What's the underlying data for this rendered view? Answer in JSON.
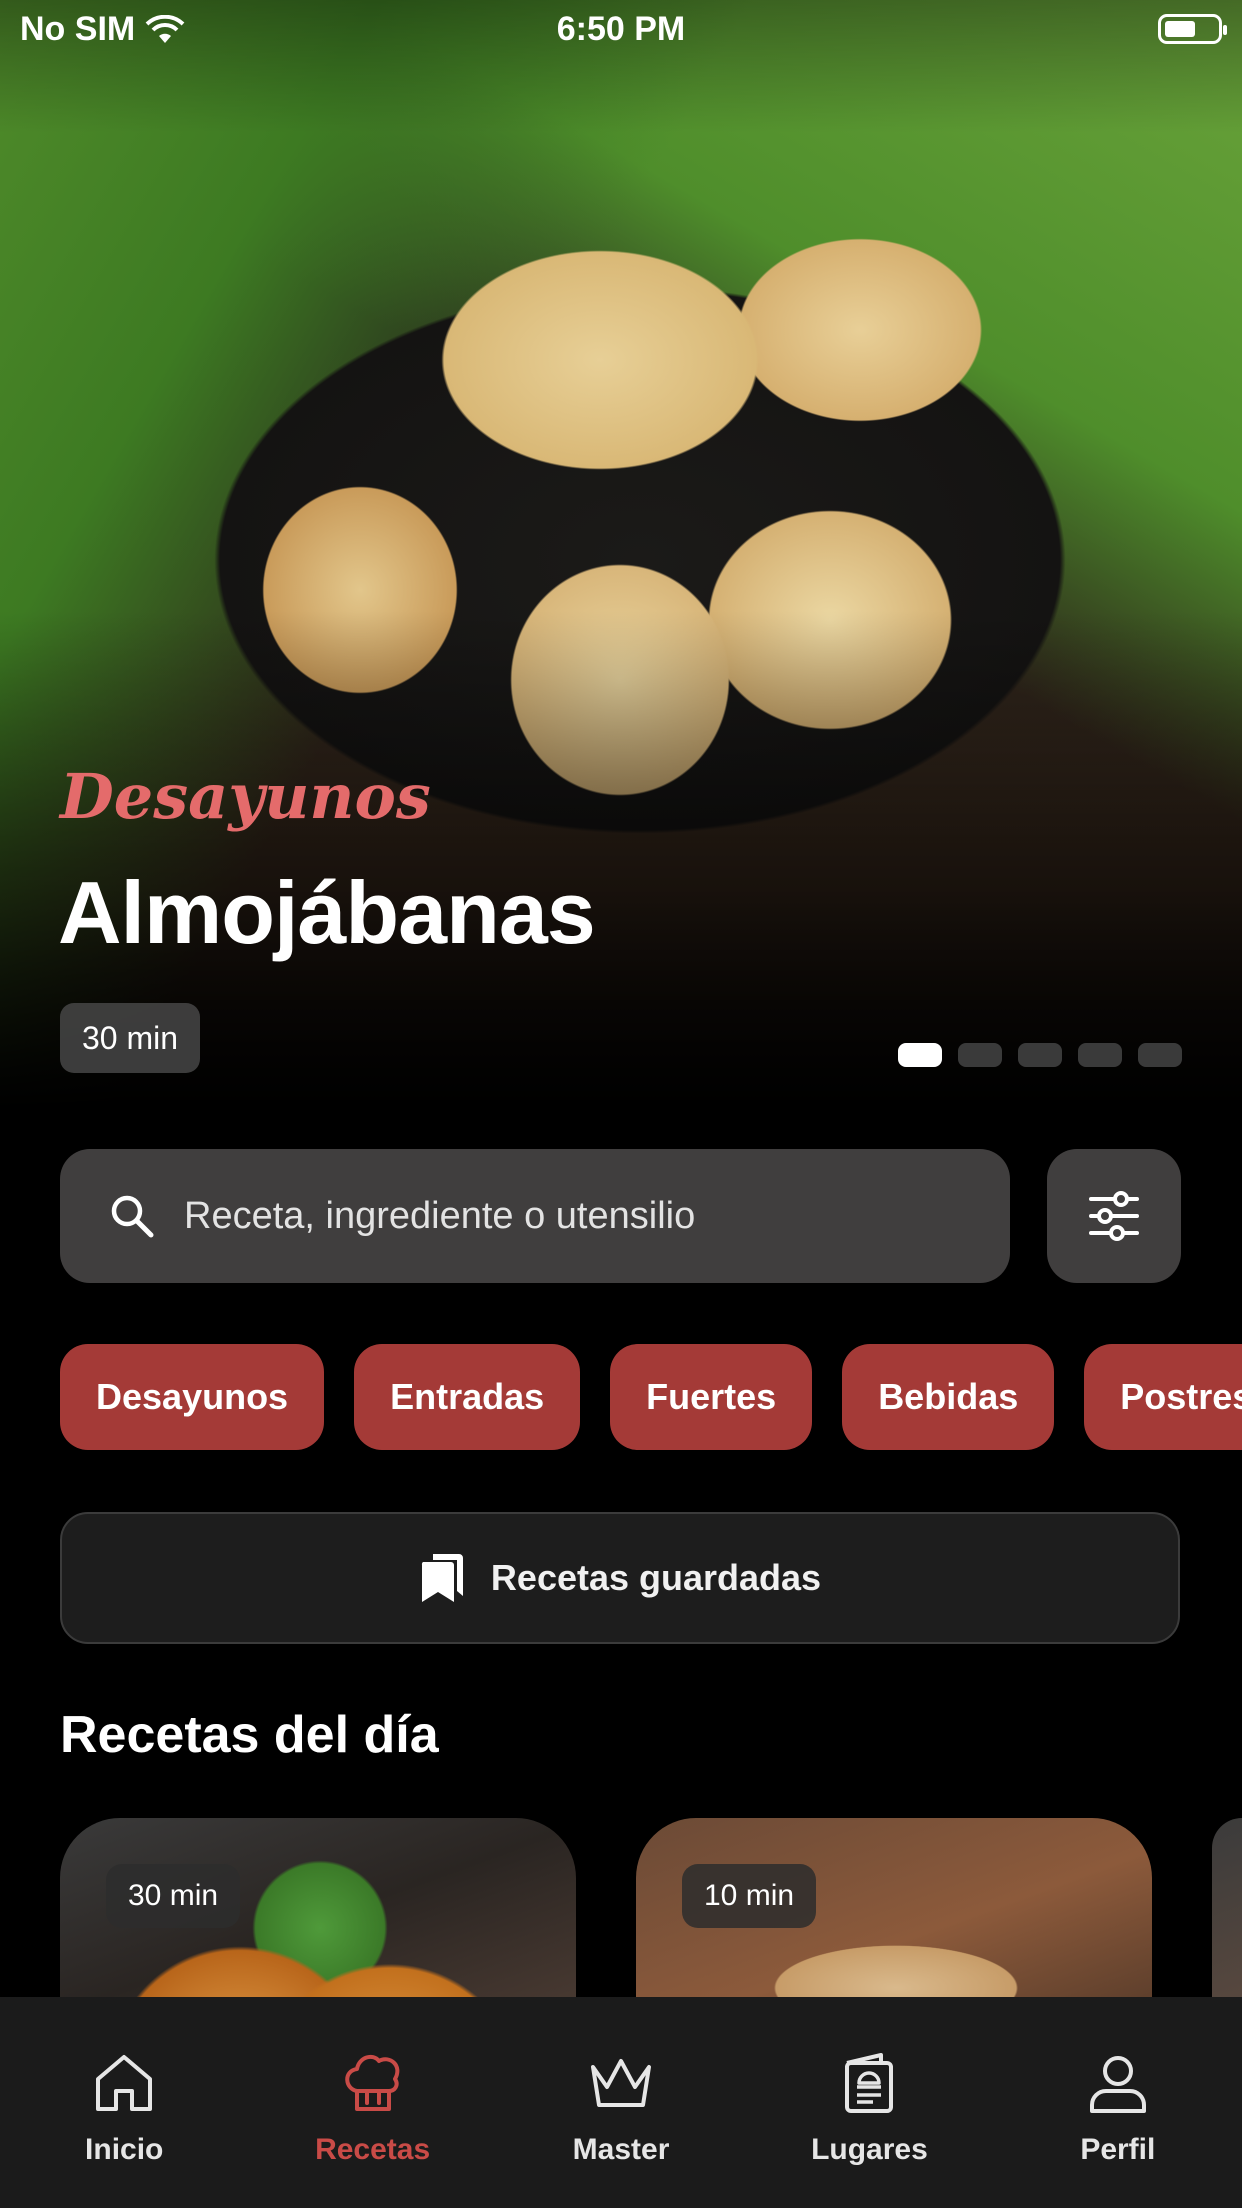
{
  "status_bar": {
    "carrier": "No SIM",
    "time": "6:50 PM"
  },
  "hero": {
    "category": "Desayunos",
    "title": "Almojábanas",
    "time": "30 min",
    "carousel_pages": 5,
    "carousel_active_index": 0
  },
  "search": {
    "placeholder": "Receta, ingrediente o utensilio"
  },
  "categories": [
    "Desayunos",
    "Entradas",
    "Fuertes",
    "Bebidas",
    "Postres"
  ],
  "saved_button": {
    "label": "Recetas guardadas"
  },
  "daily_section": {
    "title": "Recetas del día",
    "cards": [
      {
        "time": "30 min"
      },
      {
        "time": "10 min"
      }
    ]
  },
  "tabbar": {
    "items": [
      {
        "label": "Inicio",
        "icon": "home-icon"
      },
      {
        "label": "Recetas",
        "icon": "chef-hat-icon",
        "active": true
      },
      {
        "label": "Master",
        "icon": "crown-icon"
      },
      {
        "label": "Lugares",
        "icon": "menu-card-icon"
      },
      {
        "label": "Perfil",
        "icon": "user-icon"
      }
    ]
  },
  "colors": {
    "accent": "#a43a37",
    "active_tab": "#c94b47",
    "category_script": "#e46b6b",
    "background": "#000000"
  }
}
